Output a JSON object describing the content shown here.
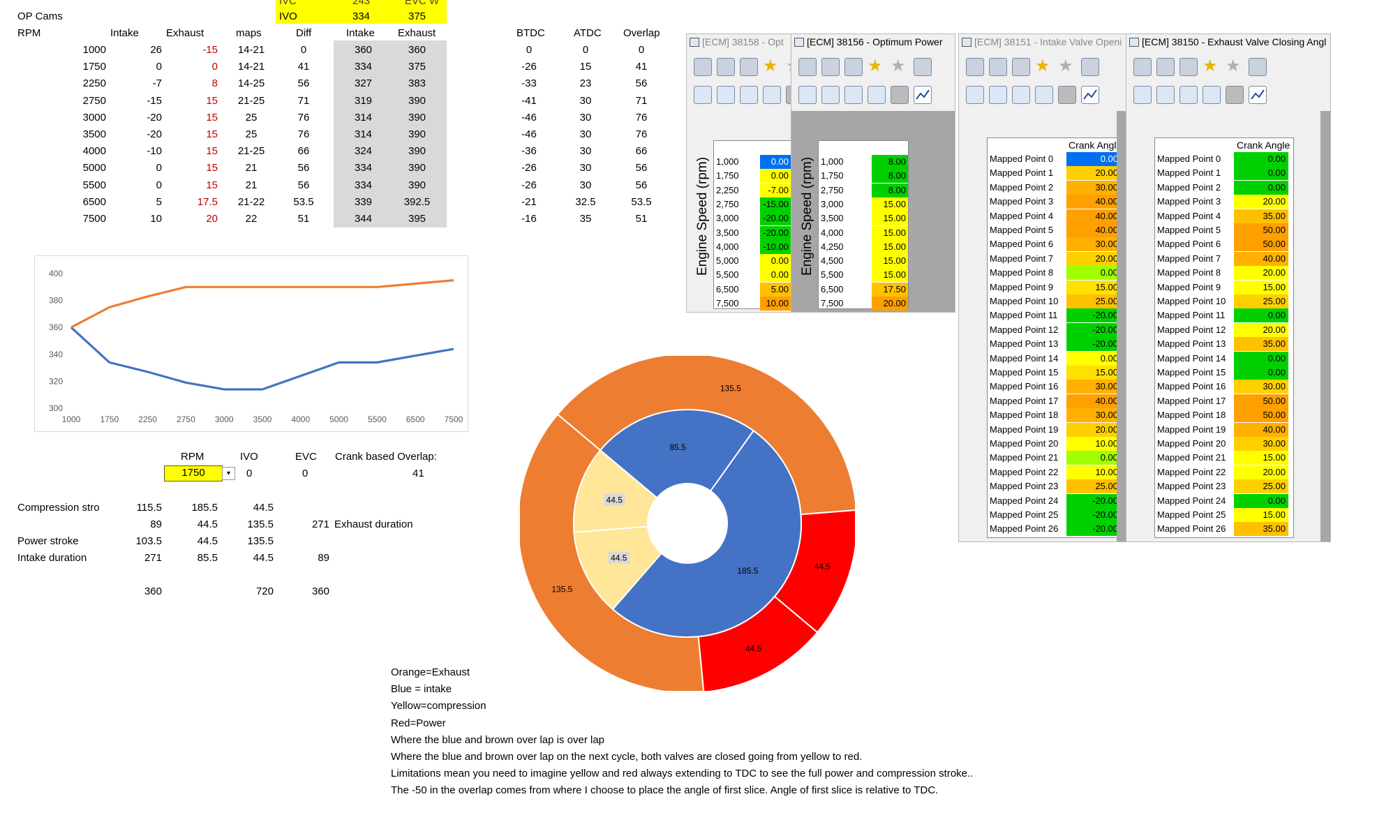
{
  "sheet": {
    "top_labels": {
      "ivc": "IVC",
      "ivc_val": "243",
      "evc": "EVC W",
      "ivo": "IVO",
      "ivo_val": "334",
      "evc_val": "375"
    },
    "title": "OP Cams",
    "headers": {
      "rpm": "RPM",
      "intake": "Intake",
      "exhaust": "Exhaust",
      "maps": "maps",
      "diff": "Diff",
      "intake2": "Intake",
      "exhaust2": "Exhaust",
      "btdc": "BTDC",
      "atdc": "ATDC",
      "overlap": "Overlap"
    },
    "rows": [
      {
        "rpm": "1000",
        "intake": "26",
        "exhaust": "-15",
        "maps": "14-21",
        "diff": "0",
        "intake2": "360",
        "exhaust2": "360",
        "btdc": "0",
        "atdc": "0",
        "overlap": "0"
      },
      {
        "rpm": "1750",
        "intake": "0",
        "exhaust": "0",
        "maps": "14-21",
        "diff": "41",
        "intake2": "334",
        "exhaust2": "375",
        "btdc": "-26",
        "atdc": "15",
        "overlap": "41"
      },
      {
        "rpm": "2250",
        "intake": "-7",
        "exhaust": "8",
        "maps": "14-25",
        "diff": "56",
        "intake2": "327",
        "exhaust2": "383",
        "btdc": "-33",
        "atdc": "23",
        "overlap": "56"
      },
      {
        "rpm": "2750",
        "intake": "-15",
        "exhaust": "15",
        "maps": "21-25",
        "diff": "71",
        "intake2": "319",
        "exhaust2": "390",
        "btdc": "-41",
        "atdc": "30",
        "overlap": "71"
      },
      {
        "rpm": "3000",
        "intake": "-20",
        "exhaust": "15",
        "maps": "25",
        "diff": "76",
        "intake2": "314",
        "exhaust2": "390",
        "btdc": "-46",
        "atdc": "30",
        "overlap": "76"
      },
      {
        "rpm": "3500",
        "intake": "-20",
        "exhaust": "15",
        "maps": "25",
        "diff": "76",
        "intake2": "314",
        "exhaust2": "390",
        "btdc": "-46",
        "atdc": "30",
        "overlap": "76"
      },
      {
        "rpm": "4000",
        "intake": "-10",
        "exhaust": "15",
        "maps": "21-25",
        "diff": "66",
        "intake2": "324",
        "exhaust2": "390",
        "btdc": "-36",
        "atdc": "30",
        "overlap": "66"
      },
      {
        "rpm": "5000",
        "intake": "0",
        "exhaust": "15",
        "maps": "21",
        "diff": "56",
        "intake2": "334",
        "exhaust2": "390",
        "btdc": "-26",
        "atdc": "30",
        "overlap": "56"
      },
      {
        "rpm": "5500",
        "intake": "0",
        "exhaust": "15",
        "maps": "21",
        "diff": "56",
        "intake2": "334",
        "exhaust2": "390",
        "btdc": "-26",
        "atdc": "30",
        "overlap": "56"
      },
      {
        "rpm": "6500",
        "intake": "5",
        "exhaust": "17.5",
        "maps": "21-22",
        "diff": "53.5",
        "intake2": "339",
        "exhaust2": "392.5",
        "btdc": "-21",
        "atdc": "32.5",
        "overlap": "53.5"
      },
      {
        "rpm": "7500",
        "intake": "10",
        "exhaust": "20",
        "maps": "22",
        "diff": "51",
        "intake2": "344",
        "exhaust2": "395",
        "btdc": "-16",
        "atdc": "35",
        "overlap": "51"
      }
    ],
    "calc": {
      "rpm_label": "RPM",
      "ivo_label": "IVO",
      "evc_label": "EVC",
      "overlap_label": "Crank based Overlap:",
      "rpm_value": "1750",
      "ivo_value": "0",
      "evc_value": "0",
      "overlap_value": "41",
      "comp_label": "Compression stro",
      "comp_vals": [
        "115.5",
        "185.5",
        "44.5"
      ],
      "row2_vals": [
        "89",
        "44.5",
        "135.5"
      ],
      "exh_dur_val": "271",
      "exh_dur_label": "Exhaust duration",
      "power_label": "Power stroke",
      "power_vals": [
        "103.5",
        "44.5",
        "135.5"
      ],
      "intake_label": "Intake duration",
      "intake_vals": [
        "271",
        "85.5",
        "44.5"
      ],
      "intake_extra": "89",
      "totals": [
        "360",
        "720",
        "360"
      ]
    },
    "notes": [
      "Orange=Exhaust",
      "Blue = intake",
      "Yellow=compression",
      "Red=Power",
      "Where the blue and brown over lap is over lap",
      "Where the blue and brown over lap on the next cycle, both valves are closed going from yellow to  red.",
      "Limitations mean you need to imagine yellow and red always extending to TDC to see the full power and compression stroke..",
      "The -50 in the overlap comes from where I choose to place the angle of first slice. Angle of first slice is relative to TDC."
    ]
  },
  "chart_data": [
    {
      "type": "line",
      "categories": [
        "1000",
        "1750",
        "2250",
        "2750",
        "3000",
        "3500",
        "4000",
        "5000",
        "5500",
        "6500",
        "7500"
      ],
      "series": [
        {
          "values": [
            360,
            334,
            327,
            319,
            314,
            314,
            324,
            334,
            334,
            339,
            344
          ],
          "color": "#4472c4"
        },
        {
          "values": [
            360,
            375,
            383,
            390,
            390,
            390,
            390,
            390,
            390,
            392.5,
            395
          ],
          "color": "#ed7d31"
        }
      ],
      "ylim": [
        300,
        400
      ],
      "yticks": [
        "300",
        "320",
        "340",
        "360",
        "380",
        "400"
      ],
      "grid": false
    },
    {
      "type": "pie",
      "outer": [
        {
          "value": 135.5,
          "label": "135.5",
          "color": "#ed7d31"
        },
        {
          "value": 44.5,
          "label": "44.5",
          "color": "#ff0000"
        },
        {
          "value": 44.5,
          "label": "44.5",
          "color": "#ff0000"
        },
        {
          "value": 135.5,
          "label": "135.5",
          "color": "#ed7d31"
        }
      ],
      "inner": [
        {
          "value": 85.5,
          "label": "85.5",
          "color": "#4472c4"
        },
        {
          "value": 185.5,
          "label": "185.5",
          "color": "#4472c4"
        },
        {
          "value": 44.5,
          "label": "44.5",
          "color": "#ffe699"
        },
        {
          "value": 44.5,
          "label": "44.5",
          "color": "#ffe699"
        }
      ]
    }
  ],
  "windows": [
    {
      "title": "[ECM] 38158 - Opt",
      "axis": "Engine Speed (rpm)",
      "rows": [
        [
          "1,000",
          "0.00",
          "#0070f0"
        ],
        [
          "1,750",
          "0.00",
          "#ffff00"
        ],
        [
          "2,250",
          "-7.00",
          "#ffff00"
        ],
        [
          "2,750",
          "-15.00",
          "#00d000"
        ],
        [
          "3,000",
          "-20.00",
          "#00d000"
        ],
        [
          "3,500",
          "-20.00",
          "#00d000"
        ],
        [
          "4,000",
          "-10.00",
          "#00d000"
        ],
        [
          "5,000",
          "0.00",
          "#ffff00"
        ],
        [
          "5,500",
          "0.00",
          "#ffff00"
        ],
        [
          "6,500",
          "5.00",
          "#ffc000"
        ],
        [
          "7,500",
          "10.00",
          "#ffa000"
        ]
      ]
    },
    {
      "title": "[ECM] 38156 - Optimum Power",
      "axis": "Engine Speed (rpm)",
      "rows": [
        [
          "1,000",
          "8.00",
          "#00d000"
        ],
        [
          "1,750",
          "8.00",
          "#00d000"
        ],
        [
          "2,750",
          "8.00",
          "#00d000"
        ],
        [
          "3,000",
          "15.00",
          "#ffff00"
        ],
        [
          "3,500",
          "15.00",
          "#ffff00"
        ],
        [
          "4,000",
          "15.00",
          "#ffff00"
        ],
        [
          "4,250",
          "15.00",
          "#ffff00"
        ],
        [
          "4,500",
          "15.00",
          "#ffff00"
        ],
        [
          "5,500",
          "15.00",
          "#ffff00"
        ],
        [
          "6,500",
          "17.50",
          "#ffc000"
        ],
        [
          "7,500",
          "20.00",
          "#ffa000"
        ]
      ]
    },
    {
      "title": "[ECM] 38151 - Intake Valve Openi",
      "header": "Crank Angle",
      "rows": [
        [
          "Mapped Point 0",
          "0.00",
          "#0070f0"
        ],
        [
          "Mapped Point 1",
          "20.00",
          "#ffd000"
        ],
        [
          "Mapped Point 2",
          "30.00",
          "#ffb000"
        ],
        [
          "Mapped Point 3",
          "40.00",
          "#ffa000"
        ],
        [
          "Mapped Point 4",
          "40.00",
          "#ffa000"
        ],
        [
          "Mapped Point 5",
          "40.00",
          "#ffa000"
        ],
        [
          "Mapped Point 6",
          "30.00",
          "#ffb000"
        ],
        [
          "Mapped Point 7",
          "20.00",
          "#ffd000"
        ],
        [
          "Mapped Point 8",
          "0.00",
          "#a0ff00"
        ],
        [
          "Mapped Point 9",
          "15.00",
          "#ffe000"
        ],
        [
          "Mapped Point 10",
          "25.00",
          "#ffc000"
        ],
        [
          "Mapped Point 11",
          "-20.00",
          "#00d000"
        ],
        [
          "Mapped Point 12",
          "-20.00",
          "#00d000"
        ],
        [
          "Mapped Point 13",
          "-20.00",
          "#00d000"
        ],
        [
          "Mapped Point 14",
          "0.00",
          "#ffff00"
        ],
        [
          "Mapped Point 15",
          "15.00",
          "#ffe000"
        ],
        [
          "Mapped Point 16",
          "30.00",
          "#ffb000"
        ],
        [
          "Mapped Point 17",
          "40.00",
          "#ffa000"
        ],
        [
          "Mapped Point 18",
          "30.00",
          "#ffb000"
        ],
        [
          "Mapped Point 19",
          "20.00",
          "#ffd000"
        ],
        [
          "Mapped Point 20",
          "10.00",
          "#ffff00"
        ],
        [
          "Mapped Point 21",
          "0.00",
          "#a0ff00"
        ],
        [
          "Mapped Point 22",
          "10.00",
          "#ffff00"
        ],
        [
          "Mapped Point 23",
          "25.00",
          "#ffc000"
        ],
        [
          "Mapped Point 24",
          "-20.00",
          "#00d000"
        ],
        [
          "Mapped Point 25",
          "-20.00",
          "#00d000"
        ],
        [
          "Mapped Point 26",
          "-20.00",
          "#00d000"
        ]
      ]
    },
    {
      "title": "[ECM] 38150 - Exhaust Valve Closing Angl",
      "header": "Crank Angle",
      "rows": [
        [
          "Mapped Point 0",
          "0.00",
          "#00d000"
        ],
        [
          "Mapped Point 1",
          "0.00",
          "#00d000"
        ],
        [
          "Mapped Point 2",
          "0.00",
          "#00d000"
        ],
        [
          "Mapped Point 3",
          "20.00",
          "#ffff00"
        ],
        [
          "Mapped Point 4",
          "35.00",
          "#ffc000"
        ],
        [
          "Mapped Point 5",
          "50.00",
          "#ffa000"
        ],
        [
          "Mapped Point 6",
          "50.00",
          "#ffa000"
        ],
        [
          "Mapped Point 7",
          "40.00",
          "#ffb000"
        ],
        [
          "Mapped Point 8",
          "20.00",
          "#ffff00"
        ],
        [
          "Mapped Point 9",
          "15.00",
          "#ffff00"
        ],
        [
          "Mapped Point 10",
          "25.00",
          "#ffd000"
        ],
        [
          "Mapped Point 11",
          "0.00",
          "#00d000"
        ],
        [
          "Mapped Point 12",
          "20.00",
          "#ffff00"
        ],
        [
          "Mapped Point 13",
          "35.00",
          "#ffc000"
        ],
        [
          "Mapped Point 14",
          "0.00",
          "#00d000"
        ],
        [
          "Mapped Point 15",
          "0.00",
          "#00d000"
        ],
        [
          "Mapped Point 16",
          "30.00",
          "#ffd000"
        ],
        [
          "Mapped Point 17",
          "50.00",
          "#ffa000"
        ],
        [
          "Mapped Point 18",
          "50.00",
          "#ffa000"
        ],
        [
          "Mapped Point 19",
          "40.00",
          "#ffb000"
        ],
        [
          "Mapped Point 20",
          "30.00",
          "#ffd000"
        ],
        [
          "Mapped Point 21",
          "15.00",
          "#ffff00"
        ],
        [
          "Mapped Point 22",
          "20.00",
          "#ffff00"
        ],
        [
          "Mapped Point 23",
          "25.00",
          "#ffd000"
        ],
        [
          "Mapped Point 24",
          "0.00",
          "#00d000"
        ],
        [
          "Mapped Point 25",
          "15.00",
          "#ffff00"
        ],
        [
          "Mapped Point 26",
          "35.00",
          "#ffc000"
        ]
      ]
    }
  ]
}
